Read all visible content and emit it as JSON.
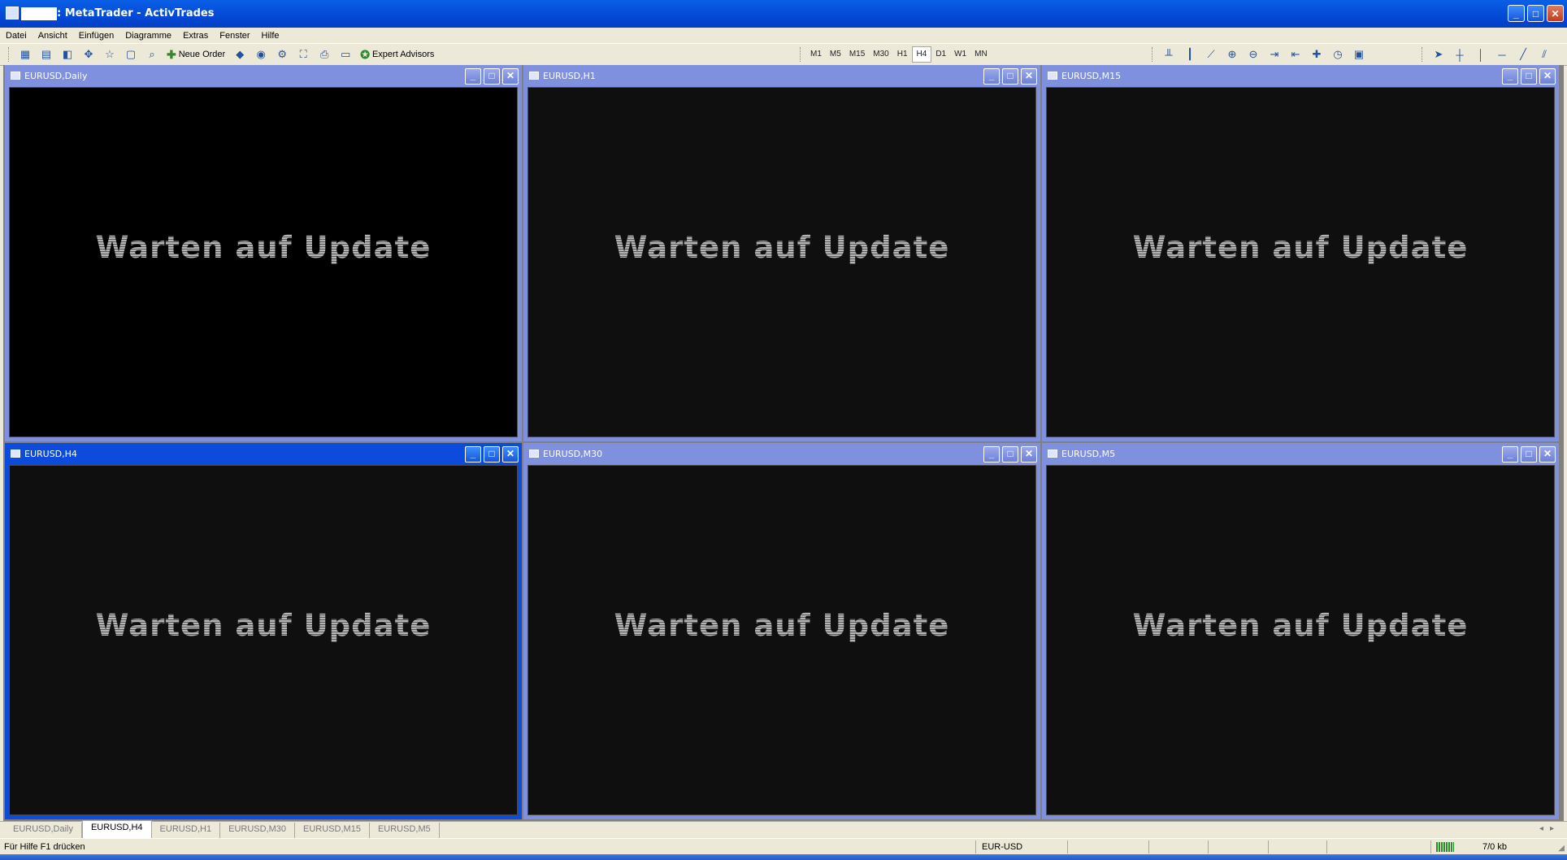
{
  "window": {
    "title": ": MetaTrader - ActivTrades",
    "controls": {
      "minimize": "_",
      "maximize": "□",
      "close": "✕"
    }
  },
  "menu": [
    "Datei",
    "Ansicht",
    "Einfügen",
    "Diagramme",
    "Extras",
    "Fenster",
    "Hilfe"
  ],
  "toolbar": {
    "new_order": "Neue Order",
    "expert_advisors": "Expert Advisors",
    "timeframes": [
      "M1",
      "M5",
      "M15",
      "M30",
      "H1",
      "H4",
      "D1",
      "W1",
      "MN"
    ],
    "active_timeframe": "H4"
  },
  "charts": [
    {
      "title": "EURUSD,Daily",
      "message": "Warten auf Update"
    },
    {
      "title": "EURUSD,H1",
      "message": "Warten auf Update"
    },
    {
      "title": "EURUSD,M15",
      "message": "Warten auf Update"
    },
    {
      "title": "EURUSD,H4",
      "message": "Warten auf Update"
    },
    {
      "title": "EURUSD,M30",
      "message": "Warten auf Update"
    },
    {
      "title": "EURUSD,M5",
      "message": "Warten auf Update"
    }
  ],
  "tabs": [
    "EURUSD,Daily",
    "EURUSD,H4",
    "EURUSD,H1",
    "EURUSD,M30",
    "EURUSD,M15",
    "EURUSD,M5"
  ],
  "active_tab": "EURUSD,H4",
  "status": {
    "help": "Für Hilfe F1 drücken",
    "symbol": "EUR-USD",
    "traffic": "7/0 kb"
  },
  "colors": {
    "titlebar": "#0449d6",
    "chart_window_inactive": "#7f90df",
    "chart_window_active": "#0c4bdc",
    "chart_background": "#0f0f0f"
  }
}
